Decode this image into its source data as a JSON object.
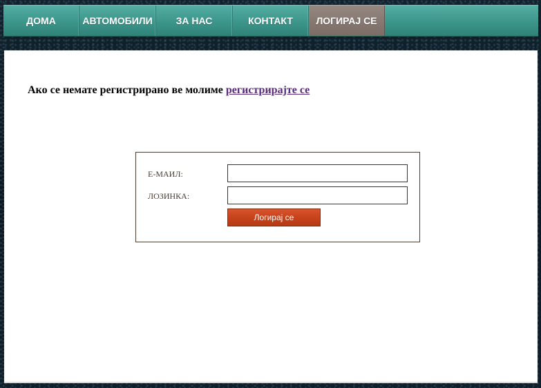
{
  "nav": {
    "items": [
      {
        "label": "ДОМА"
      },
      {
        "label": "АВТОМОБИЛИ"
      },
      {
        "label": "ЗА НАС"
      },
      {
        "label": "КОНТАКТ"
      },
      {
        "label": "ЛОГИРАЈ СЕ",
        "active": true
      }
    ]
  },
  "notice": {
    "text": "Ако се немате регистрирано ве молиме ",
    "link_text": "регистрирајте се"
  },
  "login": {
    "email_label": "Е-МАИЛ:",
    "email_value": "",
    "password_label": "ЛОЗИНКА:",
    "password_value": "",
    "submit_label": "Логирај се"
  },
  "colors": {
    "nav_teal": "#3d958a",
    "nav_active": "#85776f",
    "button_red": "#c7431c",
    "link_purple": "#5a2a7a"
  }
}
